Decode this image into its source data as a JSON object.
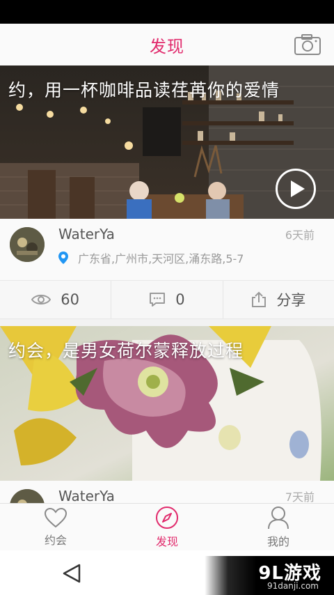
{
  "header": {
    "title": "发现",
    "camera_icon": "camera-icon"
  },
  "posts": [
    {
      "caption": "约，用一杯咖啡品读荏苒你的爱情",
      "author": "WaterYa",
      "time_ago": "6天前",
      "location": "广东省,广州市,天河区,涌东路,5-7",
      "views": "60",
      "comments": "0",
      "share_label": "分享",
      "has_video": true
    },
    {
      "caption": "约会，是男女荷尔蒙释放过程",
      "author": "WaterYa",
      "time_ago": "7天前"
    }
  ],
  "tabs": [
    {
      "label": "约会",
      "icon": "heart-icon",
      "active": false
    },
    {
      "label": "发现",
      "icon": "compass-icon",
      "active": true
    },
    {
      "label": "我的",
      "icon": "person-icon",
      "active": false
    }
  ],
  "watermark": {
    "logo": "9L游戏",
    "url": "91danji.com"
  },
  "colors": {
    "accent": "#e12a6c",
    "location_pin": "#2196f3"
  }
}
